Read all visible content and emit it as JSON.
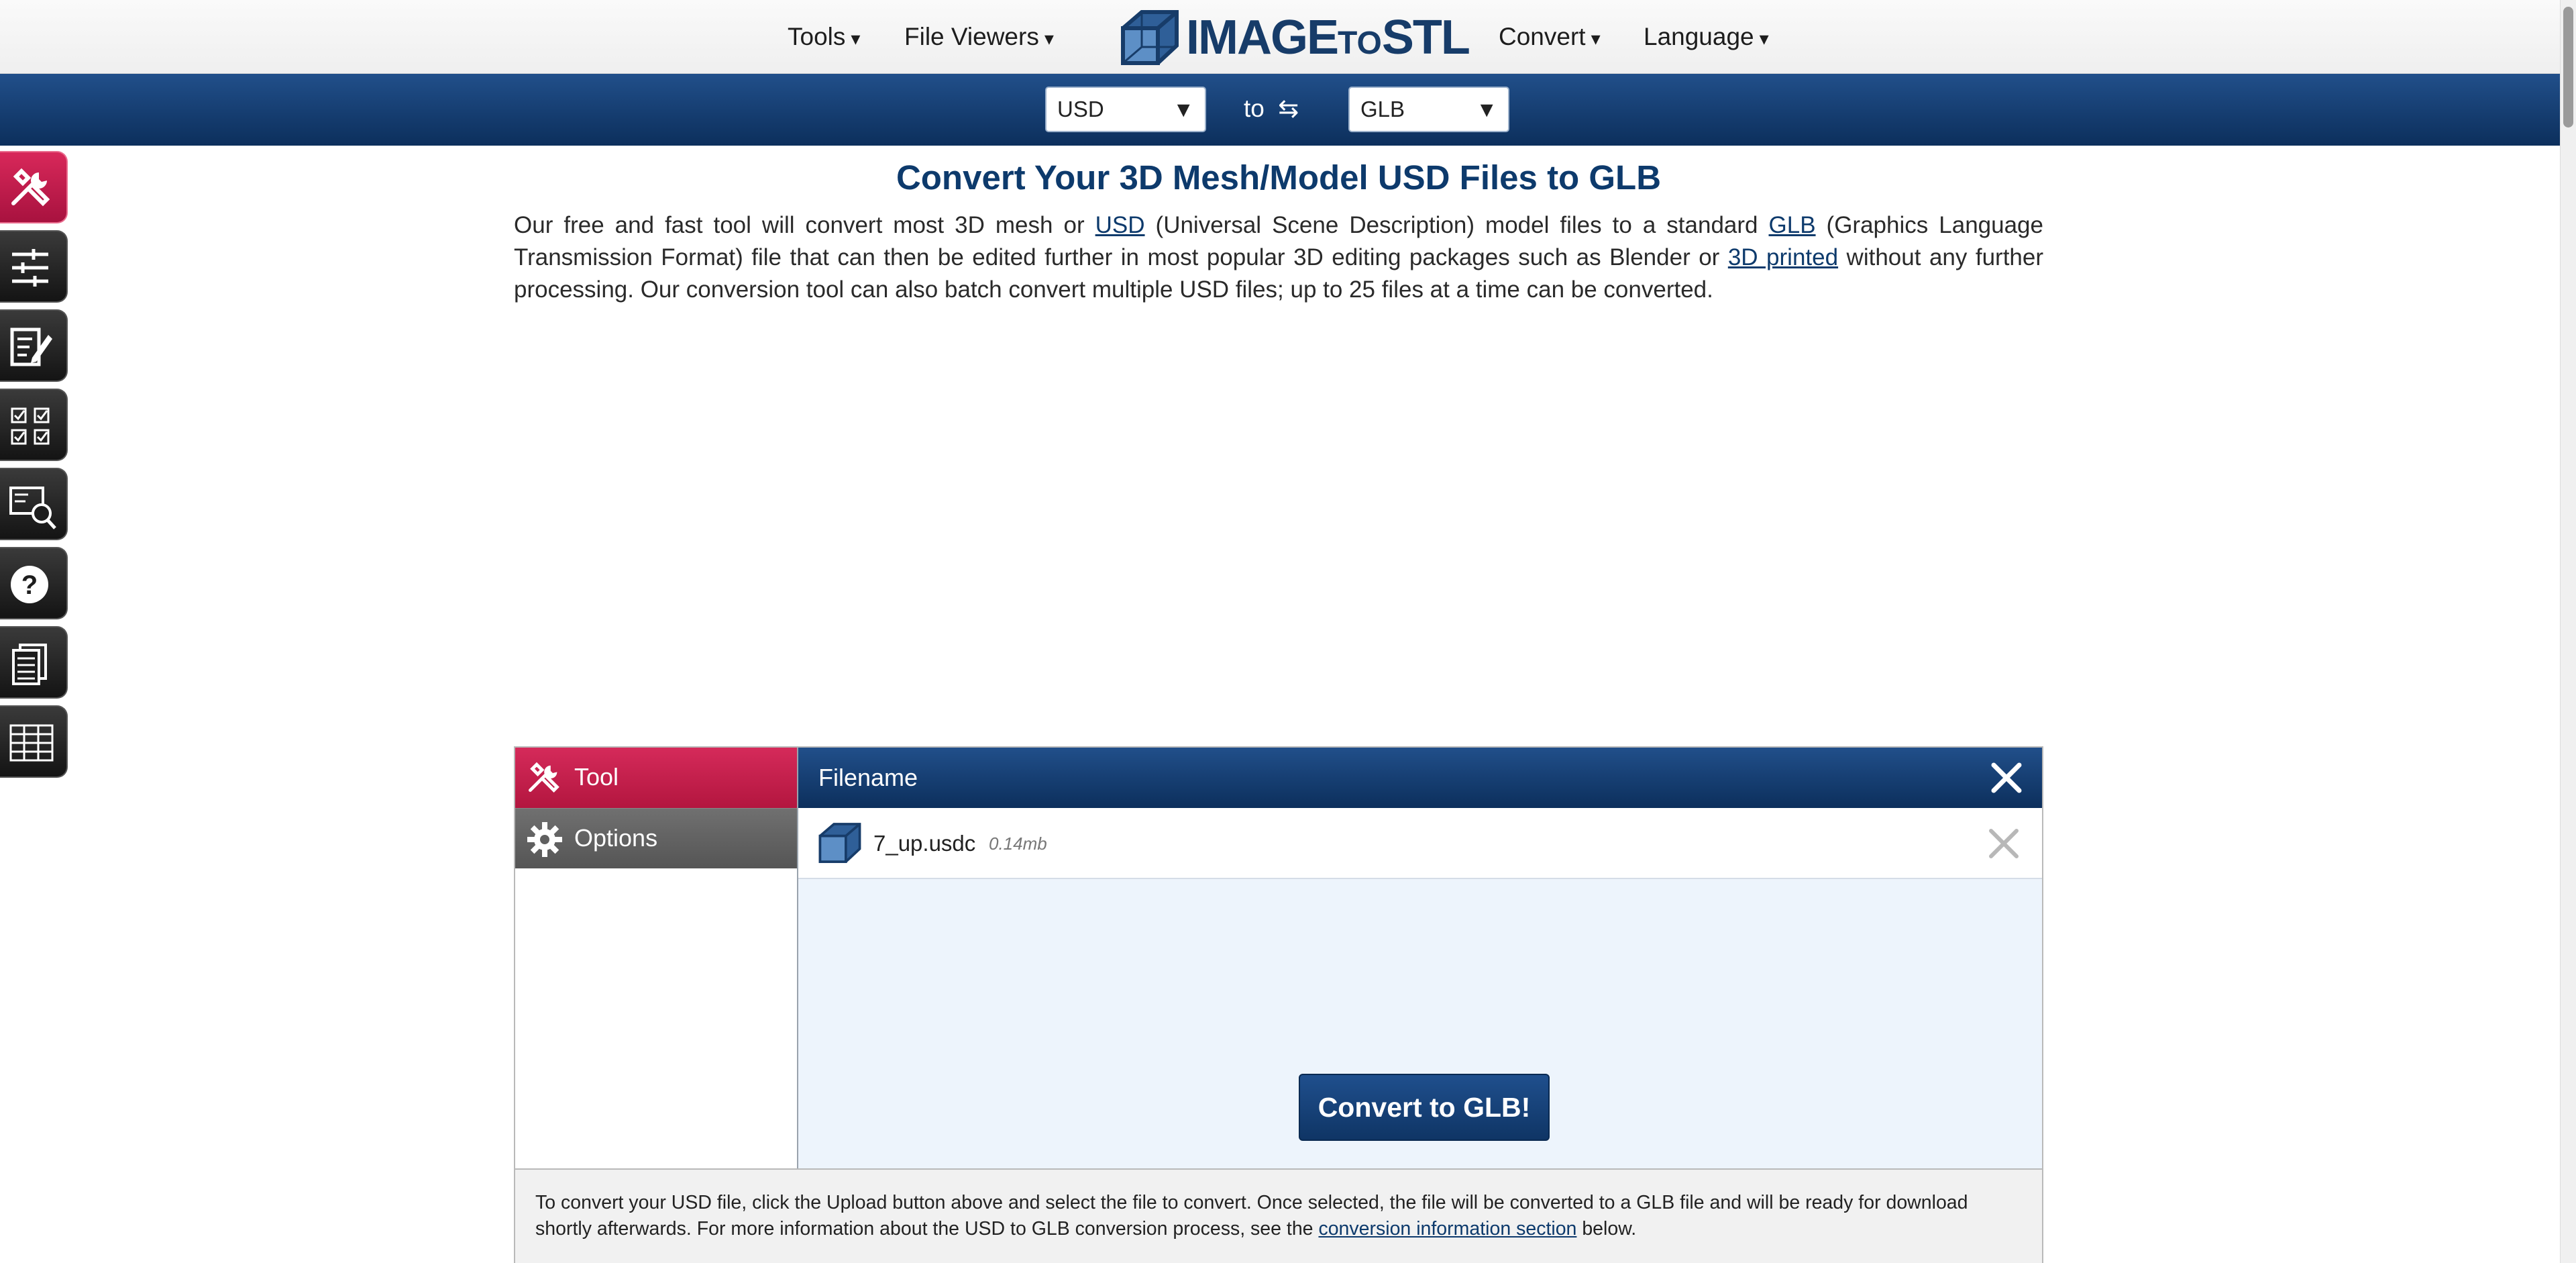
{
  "nav": {
    "tools": "Tools",
    "file_viewers": "File Viewers",
    "convert": "Convert",
    "language": "Language",
    "caret": "▾",
    "logo_main": "IMAGE",
    "logo_to": "TO",
    "logo_end": "STL"
  },
  "selector": {
    "from_value": "USD",
    "to_label": "to",
    "swap_glyph": "⇆",
    "to_value": "GLB",
    "arrow": "▼"
  },
  "sidebar": {
    "items": [
      {
        "icon": "tools-icon",
        "active": true
      },
      {
        "icon": "sliders-icon",
        "active": false
      },
      {
        "icon": "edit-document-icon",
        "active": false
      },
      {
        "icon": "checklist-icon",
        "active": false
      },
      {
        "icon": "search-document-icon",
        "active": false
      },
      {
        "icon": "help-icon",
        "active": false
      },
      {
        "icon": "documents-icon",
        "active": false
      },
      {
        "icon": "table-grid-icon",
        "active": false
      }
    ]
  },
  "main": {
    "title": "Convert Your 3D Mesh/Model USD Files to GLB",
    "intro_1": "Our free and fast tool will convert most 3D mesh or ",
    "intro_link_usd": "USD",
    "intro_2": " (Universal Scene Description) model files to a standard ",
    "intro_link_glb": "GLB",
    "intro_3": " (Graphics Language Transmission Format) file that can then be edited further in most popular 3D editing packages such as Blender or ",
    "intro_link_3d": "3D printed",
    "intro_4": " without any further processing. Our conversion tool can also batch convert multiple USD files; up to 25 files at a time can be converted."
  },
  "panel": {
    "tab_tool": "Tool",
    "tab_options": "Options",
    "filename_header": "Filename",
    "files": [
      {
        "name": "7_up.usdc",
        "size": "0.14mb"
      }
    ],
    "convert_button": "Convert to GLB!",
    "foot_1": "To convert your USD file, click the Upload button above and select the file to convert. Once selected, the file will be converted to a GLB file and will be ready for download shortly afterwards. For more information about the USD to GLB conversion process, see the ",
    "foot_link": "conversion information section",
    "foot_2": " below."
  },
  "colors": {
    "brand_navy": "#0d3a6c",
    "accent_crimson": "#c41e4e",
    "bar_blue": "#1a467f"
  }
}
